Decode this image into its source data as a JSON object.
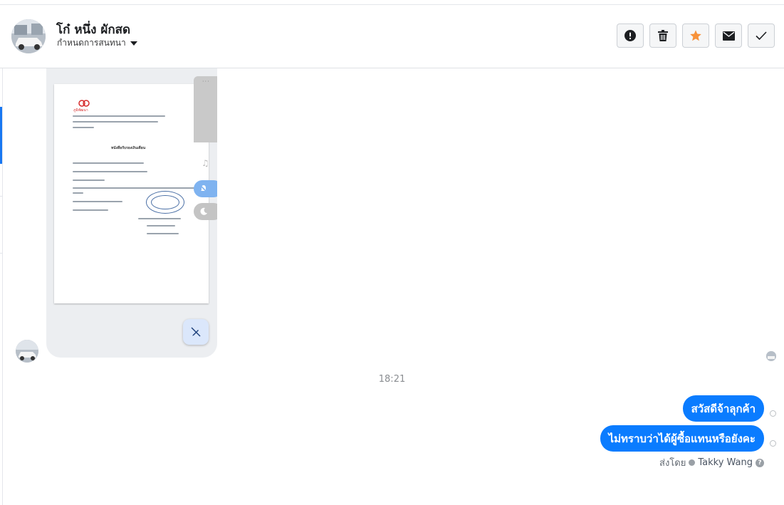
{
  "header": {
    "contact_name": "โก๋ หนึ่ง ผักสด",
    "assign_label": "กำหนดการสนทนา",
    "actions": {
      "alert": "alert-icon",
      "delete": "trash-icon",
      "star": "star-icon",
      "mail": "envelope-icon",
      "done": "check-icon"
    }
  },
  "colors": {
    "bubble": "#0a7cff",
    "star": "#f7923a",
    "accent": "#1877f2"
  },
  "conversation": {
    "attachment": {
      "document_title": "หนังสือรับรองเงินเดือน",
      "logo_text": "ภูมิพัฒนา",
      "stamp_text": "ภูมิพัฒนา",
      "prev_mark": "<",
      "next_mark": ">"
    },
    "timestamp": "18:21",
    "outgoing": [
      {
        "text": "สวัสดีจ้าลุกค้า"
      },
      {
        "text": "ไม่ทราบว่าได้ผู้ซื้อแทนหรือยังคะ"
      }
    ],
    "sent_by_label": "ส่งโดย",
    "agent_name": "Takky Wang",
    "help_glyph": "?"
  }
}
